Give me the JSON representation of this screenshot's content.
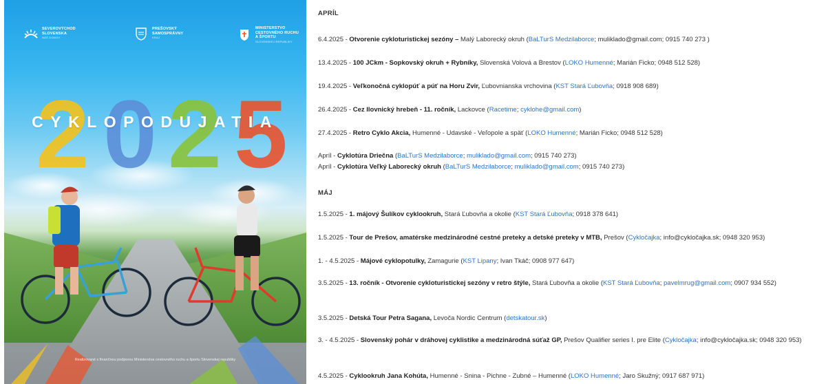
{
  "poster": {
    "logo1": {
      "line1": "SEVEROVÝCHOD",
      "line2": "SLOVENSKA",
      "line3": "NÁŠ DOMOV"
    },
    "logo2": {
      "line1": "PREŠOVSKÝ",
      "line2": "SAMOSPRÁVNY",
      "line3": "KRAJ"
    },
    "logo3": {
      "line1": "MINISTERSTVO",
      "line2": "CESTOVNÉHO RUCHU",
      "line3": "A ŠPORTU",
      "line4": "SLOVENSKEJ REPUBLIKY"
    },
    "year_digits": [
      "2",
      "0",
      "2",
      "5"
    ],
    "title": "CYKLOPODUJATIA",
    "footer": "Realizované s finančnou podporou Ministerstva cestovného ruchu a športu Slovenskej republiky",
    "colors": {
      "yellow": "#f4c21b",
      "blue": "#5c8fd9",
      "green": "#8ac33a",
      "red": "#e9542e"
    }
  },
  "months": {
    "april": "APRÍL",
    "may": "MÁJ"
  },
  "events": [
    {
      "date": "6.4.2025 - ",
      "title": "Otvorenie cykloturistickej sezóny – ",
      "detail": "Malý Laborecký okruh (",
      "link1": "BaLTurS Medzilaborce",
      "rest": "; muliklado@gmail.com; 0915 740 273 )"
    },
    {
      "date": "13.4.2025 - ",
      "title": "100 JCkm - Sopkovský okruh + Rybníky, ",
      "detail": "Slovenská Volová a Brestov (",
      "link1": "LOKO Humenné",
      "rest": "; Marián Ficko; 0948 512 528)"
    },
    {
      "date": "19.4.2025 - ",
      "title": "Veľkonočná cyklopúť a púť na Horu Zvir, ",
      "detail": "Ľubovnianska vrchovina (",
      "link1": "KST Stará Ľubovňa",
      "rest": "; 0918 908 689)"
    },
    {
      "date": "26.4.2025 - ",
      "title": "Cez Ilovnický hrebeň - 11. ročník, ",
      "detail": "Lackovce (",
      "link1": "Racetime",
      "sep": "; ",
      "link2": "cyklohe@gmail.com",
      "rest": ")"
    },
    {
      "date": "27.4.2025 - ",
      "title": "Retro Cyklo Akcia, ",
      "detail": "Humenné - Udavské - Veľopole a späť (",
      "link1": "LOKO Humenné",
      "rest": "; Marián Ficko; 0948 512 528)"
    },
    {
      "date": "Apríl - ",
      "title": "Cyklotúra Driečna ",
      "detail": "(",
      "link1": "BaLTurS Medzilaborce",
      "sep": "; ",
      "link2": "muliklado@gmail.com",
      "rest": "; 0915 740 273)"
    },
    {
      "date": "Apríl - ",
      "title": "Cyklotúra Veľký Laborecký okruh ",
      "detail": "(",
      "link1": "BaLTurS Medzilaborce",
      "sep": "; ",
      "link2": "muliklado@gmail.com",
      "rest": "; 0915 740 273)"
    },
    {
      "date": "1.5.2025 - ",
      "title": "1. májový Šulíkov cyklookruh, ",
      "detail": " Stará Ľubovňa a okolie (",
      "link1": "KST Stará Ľubovňa",
      "rest": "; 0918 378 641)"
    },
    {
      "date": "1.5.2025 - ",
      "title": "Tour de Prešov, amatérske medzinárodné cestné preteky a detské preteky v MTB, ",
      "detail": "Prešov (",
      "link1": "Cykločajka",
      "rest": "; info@cykločajka.sk; 0948 320 953)"
    },
    {
      "date": "1. -  4.5.2025 - ",
      "title": "Májové cyklopotulky, ",
      "detail": "Zamagurie (",
      "link1": "KST Lipany",
      "rest": "; Ivan Tkáč; 0908 977 647)"
    },
    {
      "date": "3.5.2025 - ",
      "title": "13. ročník - Otvorenie cykloturistickej sezóny v retro štýle, ",
      "detail": "Stará Ľubovňa a okolie (",
      "link1": "KST Stará Ľubovňa",
      "sep": "; ",
      "link2": "pavelmrug@gmail.com",
      "rest": "; 0907 934 552)"
    },
    {
      "date": "3.5.2025 - ",
      "title": "Detská Tour Petra Sagana, ",
      "detail": "Levoča Nordic Centrum (",
      "link1": "detskatour.sk",
      "rest": ")"
    },
    {
      "date": "3. - 4.5.2025 - ",
      "title": "Slovenský pohár v dráhovej cyklistike a medzinárodná súťaž GP, ",
      "detail": "Prešov Qualifier series I. pre Elite (",
      "link1": "Cykločajka",
      "rest": "; info@cykločajka.sk; 0948 320 953)"
    },
    {
      "date": "4.5.2025 - ",
      "title": "Cyklookruh Jana Kohúta, ",
      "detail": "Humenné - Snina - Pichne - Zubné – Humenné (",
      "link1": "LOKO Humenné",
      "rest": "; Jaro Skužný; 0917 687 971)"
    }
  ]
}
